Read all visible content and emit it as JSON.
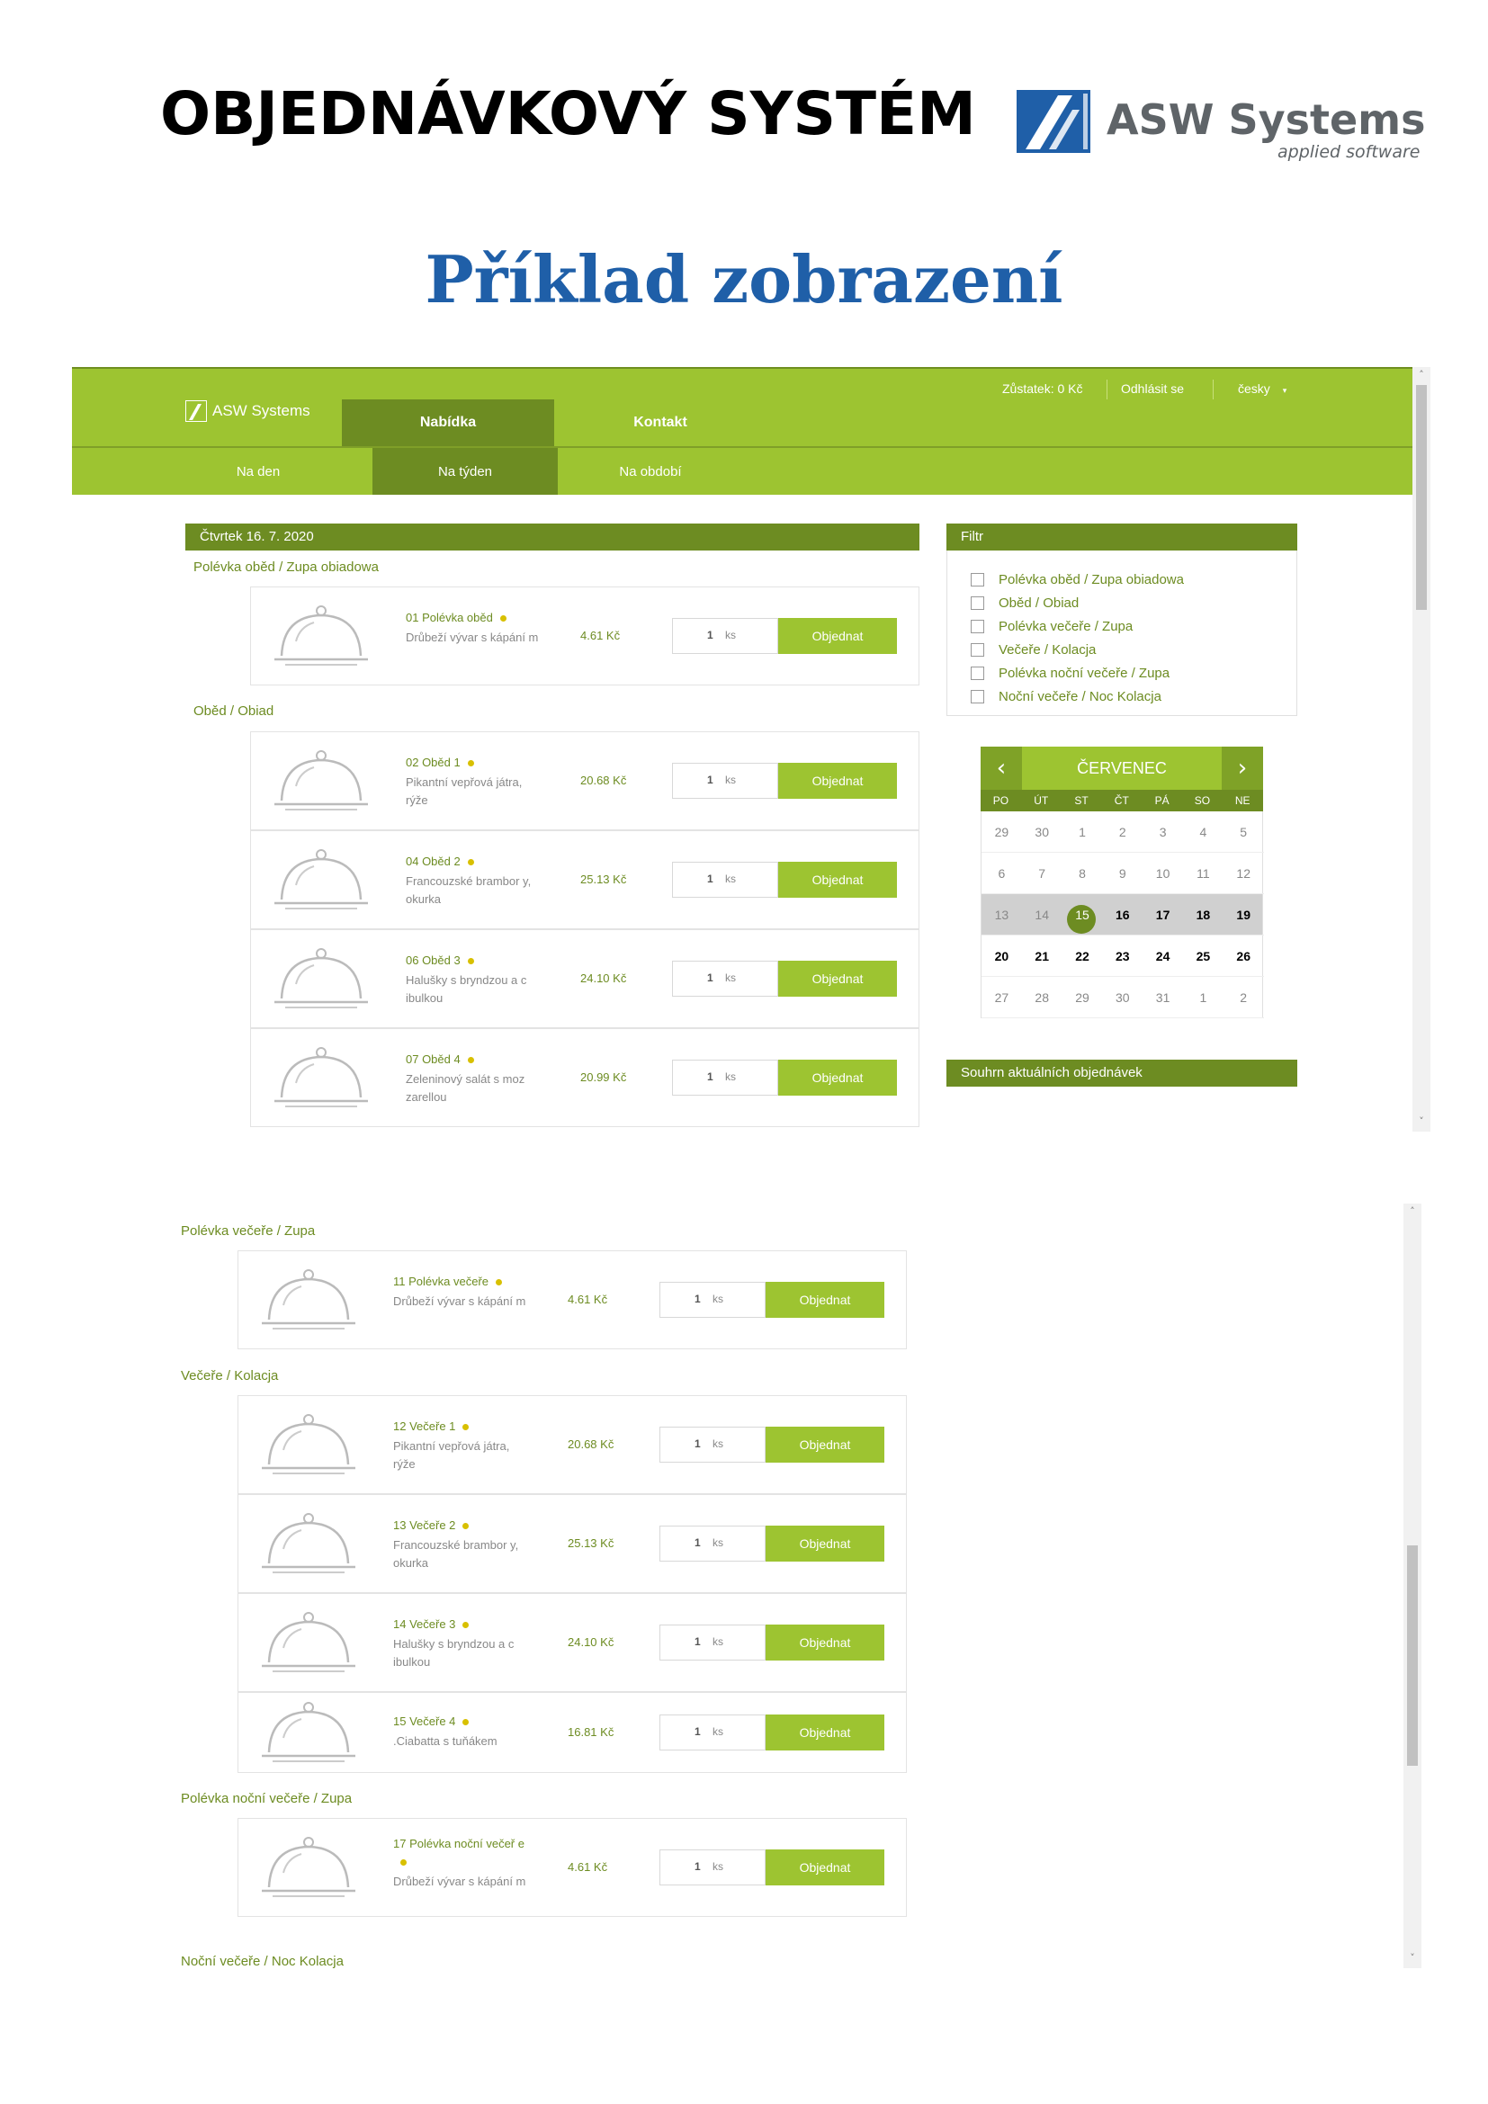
{
  "document": {
    "title": "OBJEDNÁVKOVÝ SYSTÉM",
    "logo": {
      "name": "ASW Systems",
      "tagline": "applied software"
    },
    "subtitle": "Příklad zobrazení"
  },
  "app": {
    "brand": "ASW Systems",
    "balance_label": "Zůstatek:",
    "balance_value": "0 Kč",
    "logout": "Odhlásit se",
    "language": "česky",
    "nav_tabs": [
      "Nabídka",
      "Kontakt"
    ],
    "sub_tabs": [
      "Na den",
      "Na týden",
      "Na období"
    ],
    "day_title": "Čtvrtek 16. 7. 2020",
    "filter": {
      "title": "Filtr",
      "options": [
        "Polévka oběd / Zupa obiadowa",
        "Oběd / Obiad",
        "Polévka večeře / Zupa",
        "Večeře / Kolacja",
        "Polévka noční večeře / Zupa",
        "Noční večeře / Noc Kolacja"
      ]
    },
    "calendar": {
      "month": "ČERVENEC",
      "prev": "‹",
      "next": "›",
      "weekdays": [
        "PO",
        "ÚT",
        "ST",
        "ČT",
        "PÁ",
        "SO",
        "NE"
      ],
      "weeks": [
        [
          "29",
          "30",
          "1",
          "2",
          "3",
          "4",
          "5"
        ],
        [
          "6",
          "7",
          "8",
          "9",
          "10",
          "11",
          "12"
        ],
        [
          "13",
          "14",
          "15",
          "16",
          "17",
          "18",
          "19"
        ],
        [
          "20",
          "21",
          "22",
          "23",
          "24",
          "25",
          "26"
        ],
        [
          "27",
          "28",
          "29",
          "30",
          "31",
          "1",
          "2"
        ]
      ],
      "selected_day": "15"
    },
    "summary": "Souhrn aktuálních objednávek",
    "order_label": "Objednat",
    "qty_value": "1",
    "qty_unit": "ks",
    "colors": {
      "green": "#9dc431",
      "dark_green": "#6d8c22",
      "dot": "#d8c000"
    }
  },
  "view1": {
    "sections": [
      {
        "label": "Polévka oběd / Zupa obiadowa",
        "items": [
          {
            "name": "01 Polévka oběd",
            "desc": "Drůbeží vývar s kápání m",
            "price": "4.61 Kč"
          }
        ]
      },
      {
        "label": "Oběd / Obiad",
        "items": [
          {
            "name": "02 Oběd 1",
            "desc": "Pikantní vepřová játra, rýže",
            "price": "20.68 Kč"
          },
          {
            "name": "04 Oběd 2",
            "desc": "Francouzské brambor y, okurka",
            "price": "25.13 Kč"
          },
          {
            "name": "06 Oběd 3",
            "desc": "Halušky s bryndzou a c ibulkou",
            "price": "24.10 Kč"
          },
          {
            "name": "07 Oběd 4",
            "desc": "Zeleninový salát s moz zarellou",
            "price": "20.99 Kč"
          }
        ]
      }
    ]
  },
  "view2": {
    "sections": [
      {
        "label": "Polévka večeře / Zupa",
        "items": [
          {
            "name": "11 Polévka večeře",
            "desc": "Drůbeží vývar s kápání m",
            "price": "4.61 Kč"
          }
        ]
      },
      {
        "label": "Večeře / Kolacja",
        "items": [
          {
            "name": "12 Večeře 1",
            "desc": "Pikantní vepřová játra, rýže",
            "price": "20.68 Kč"
          },
          {
            "name": "13 Večeře 2",
            "desc": "Francouzské brambor y, okurka",
            "price": "25.13 Kč"
          },
          {
            "name": "14 Večeře 3",
            "desc": "Halušky s bryndzou a c ibulkou",
            "price": "24.10 Kč"
          },
          {
            "name": "15 Večeře 4",
            "desc": ".Ciabatta s tuňákem",
            "price": "16.81 Kč"
          }
        ]
      },
      {
        "label": "Polévka noční večeře / Zupa",
        "items": [
          {
            "name": "17 Polévka noční večeř e",
            "desc": "Drůbeží vývar s kápání m",
            "price": "4.61 Kč"
          }
        ]
      },
      {
        "label": "Noční večeře / Noc Kolacja",
        "items": []
      }
    ]
  }
}
